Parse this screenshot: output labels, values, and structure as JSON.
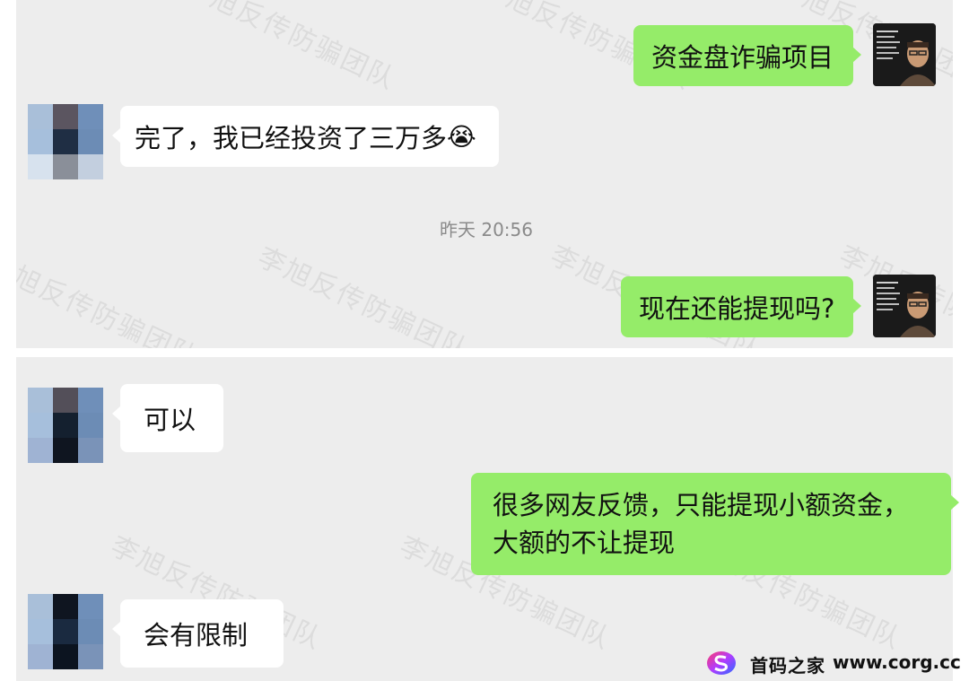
{
  "watermark_text": "李旭反传防骗团队",
  "messages": {
    "m1": "资金盘诈骗项目",
    "m2": "完了，我已经投资了三万多",
    "m2_emoji": "😭",
    "timestamp": "昨天 20:56",
    "m3": "现在还能提现吗?",
    "m4": "可以",
    "m5_line1": "很多网友反馈，只能提现小额资金，",
    "m5_line2": "大额的不让提现",
    "m6": "会有限制"
  },
  "brand": {
    "name": "首码之家",
    "url": "www.corg.cc"
  },
  "colors": {
    "chat_bg": "#ededed",
    "self_bubble": "#95ec69",
    "other_bubble": "#ffffff",
    "timestamp": "#8a8a8a"
  }
}
